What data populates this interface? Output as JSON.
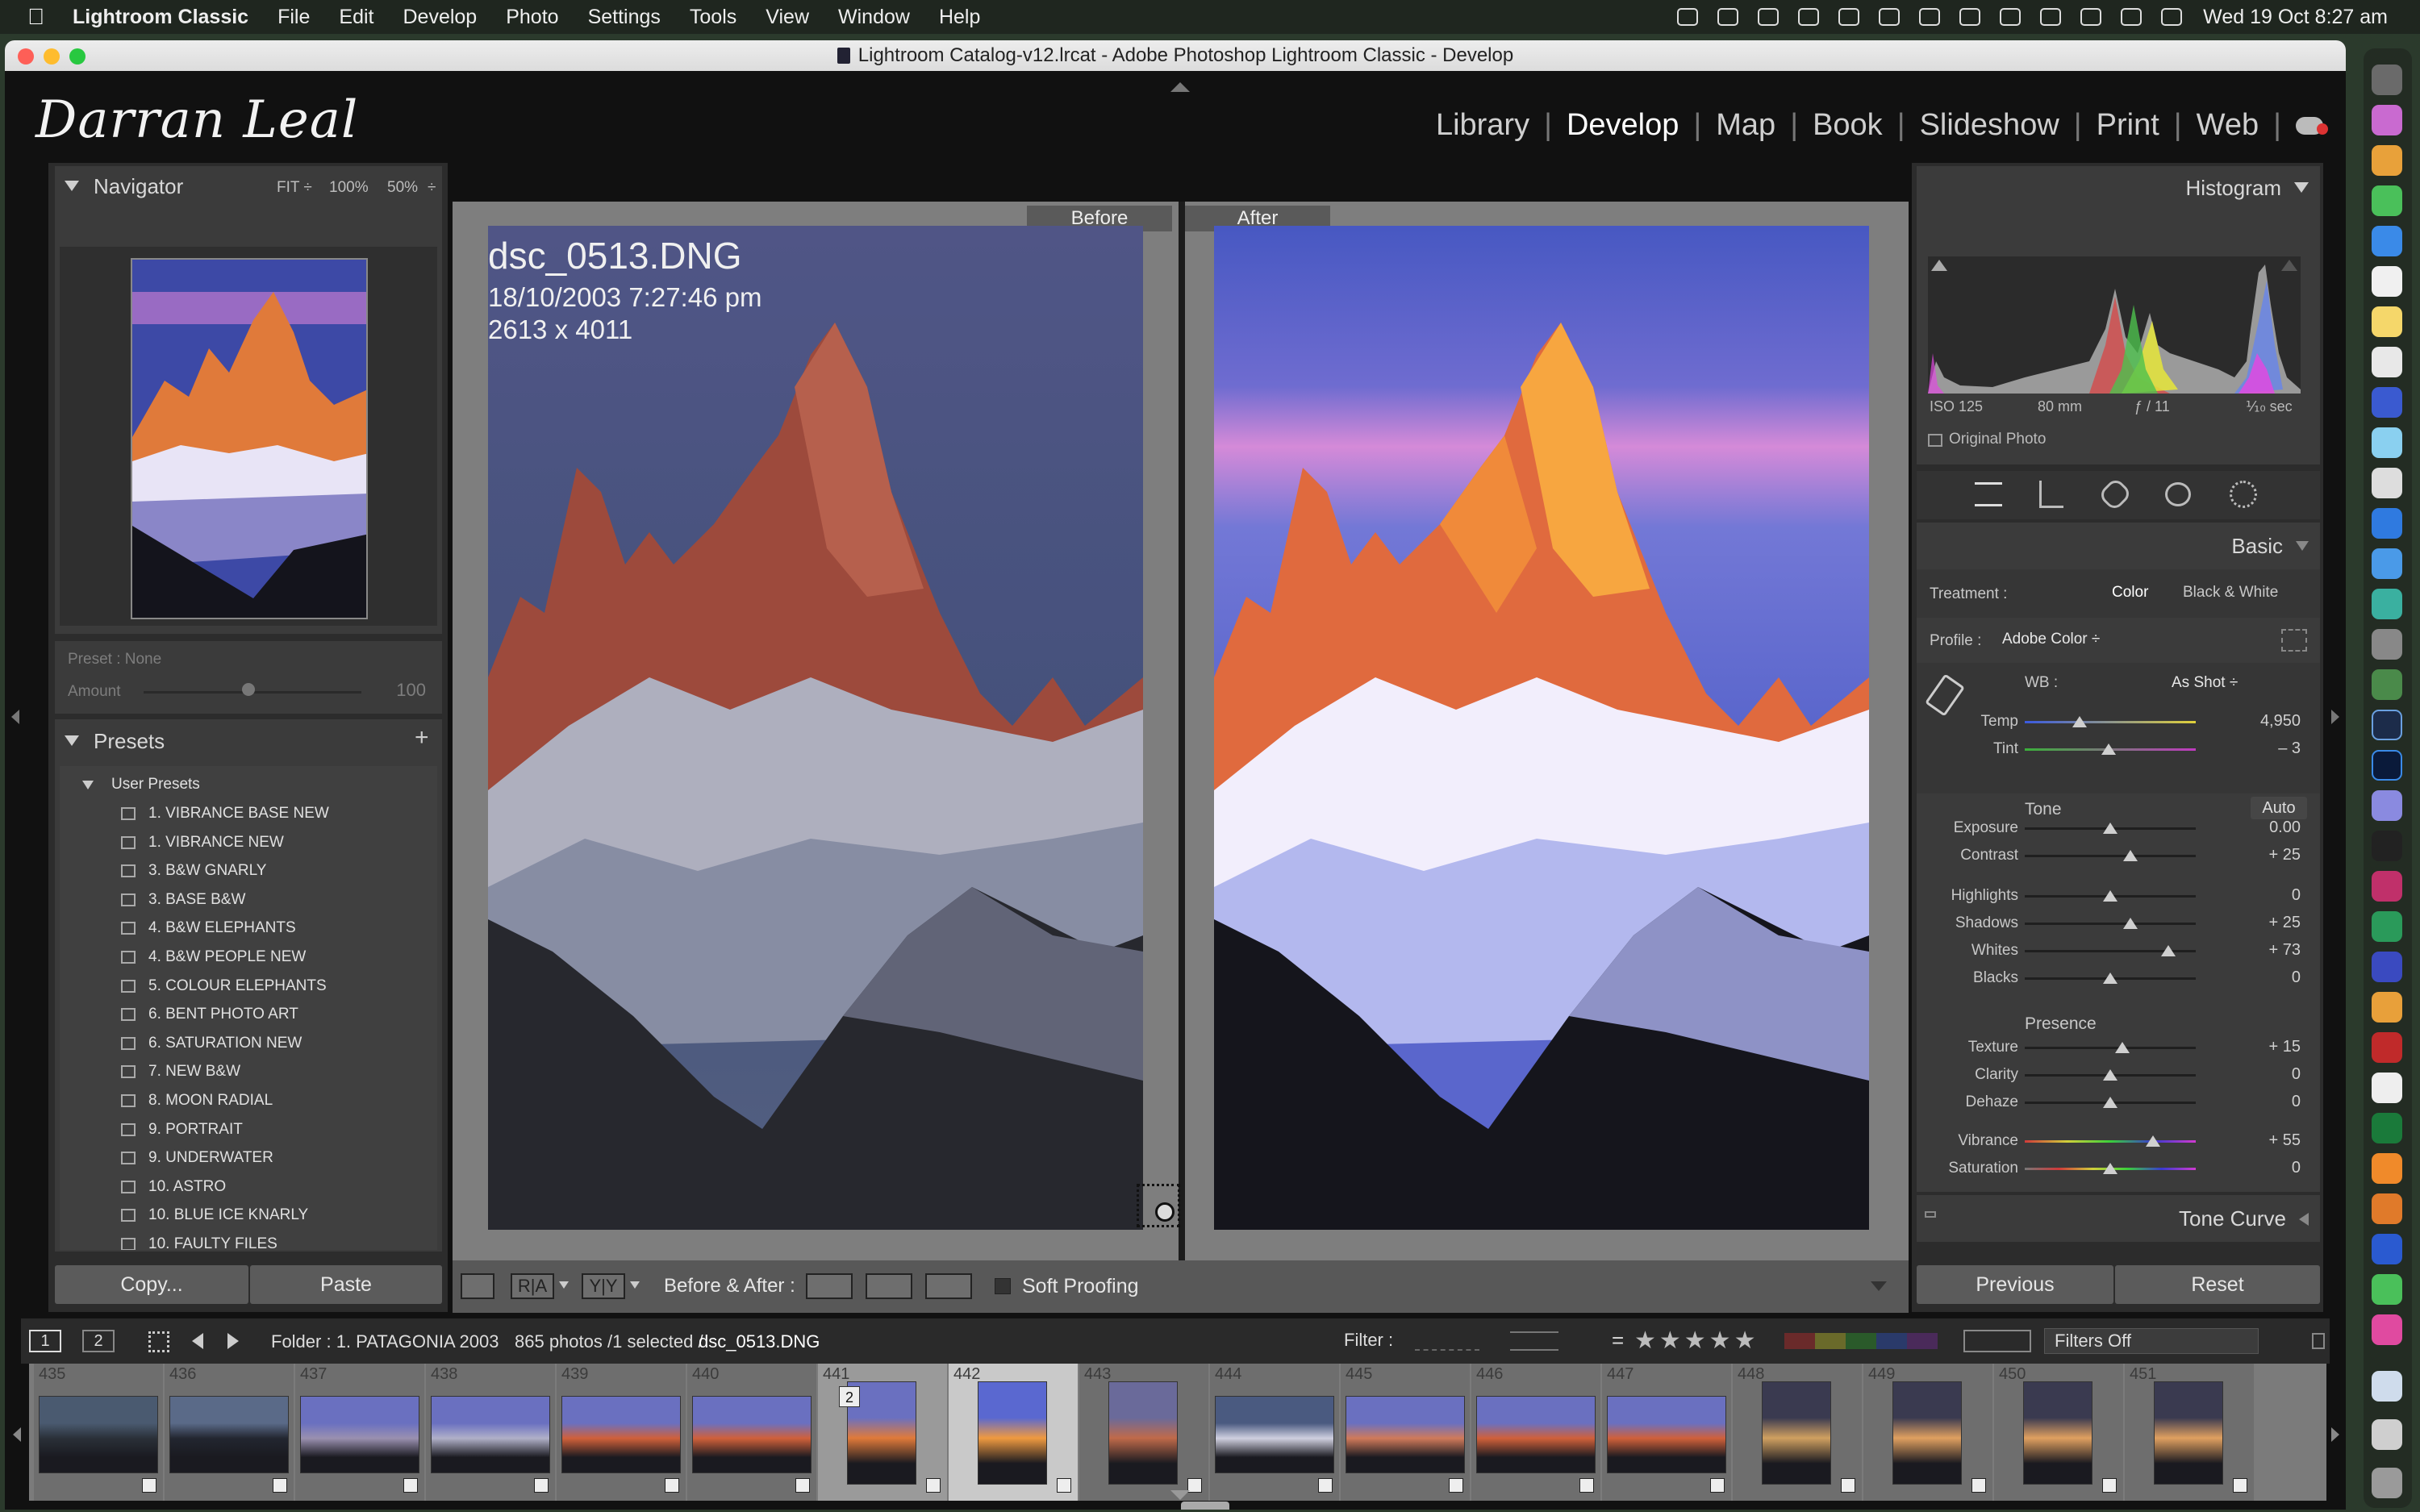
{
  "menubar": {
    "app_name": "Lightroom Classic",
    "items": [
      "File",
      "Edit",
      "Develop",
      "Photo",
      "Settings",
      "Tools",
      "View",
      "Window",
      "Help"
    ],
    "clock": "Wed 19 Oct  8:27 am"
  },
  "window": {
    "title": "Lightroom Catalog-v12.lrcat - Adobe Photoshop Lightroom Classic - Develop"
  },
  "identity_plate": "Darran Leal",
  "modules": [
    "Library",
    "Develop",
    "Map",
    "Book",
    "Slideshow",
    "Print",
    "Web"
  ],
  "active_module": "Develop",
  "navigator": {
    "title": "Navigator",
    "zoom_options": [
      "FIT ÷",
      "100%",
      "50%",
      "÷"
    ]
  },
  "preset_amount": {
    "preset_label": "Preset : None",
    "amount_label": "Amount",
    "amount_value": "100"
  },
  "presets": {
    "title": "Presets",
    "add_icon": "+",
    "group": "User Presets",
    "items": [
      "1. VIBRANCE BASE NEW",
      "1. VIBRANCE NEW",
      "3. B&W GNARLY",
      "3. BASE B&W",
      "4. B&W ELEPHANTS",
      "4. B&W PEOPLE NEW",
      "5. COLOUR ELEPHANTS",
      "6. BENT PHOTO ART",
      "6. SATURATION NEW",
      "7. NEW B&W",
      "8. MOON RADIAL",
      "9. PORTRAIT",
      "9. UNDERWATER",
      "10. ASTRO",
      "10. BLUE ICE KNARLY",
      "10. FAULTY FILES"
    ]
  },
  "left_buttons": {
    "copy": "Copy...",
    "paste": "Paste"
  },
  "photo_info": {
    "filename": "dsc_0513.DNG",
    "datetime": "18/10/2003 7:27:46 pm",
    "dimensions": "2613 x 4011"
  },
  "before_after": {
    "before": "Before",
    "after": "After"
  },
  "toolbar": {
    "before_after_label": "Before & After :",
    "soft_proofing": "Soft Proofing",
    "ra_label": "R|A",
    "yy_label": "Y|Y"
  },
  "histogram": {
    "title": "Histogram",
    "iso": "ISO 125",
    "focal": "80 mm",
    "aperture": "ƒ / 11",
    "shutter": "⅒ sec",
    "original_photo": "Original Photo"
  },
  "basic": {
    "title": "Basic",
    "treatment_label": "Treatment :",
    "treatment_color": "Color",
    "treatment_bw": "Black & White",
    "profile_label": "Profile :",
    "profile_value": "Adobe Color ÷",
    "wb_label": "WB :",
    "wb_value": "As Shot ÷",
    "tone_label": "Tone",
    "auto_label": "Auto",
    "presence_label": "Presence",
    "sliders": [
      {
        "label": "Temp",
        "value": "4,950",
        "pos": 0.32
      },
      {
        "label": "Tint",
        "value": "– 3",
        "pos": 0.49
      },
      {
        "label": "Exposure",
        "value": "0.00",
        "pos": 0.5
      },
      {
        "label": "Contrast",
        "value": "+ 25",
        "pos": 0.62
      },
      {
        "label": "Highlights",
        "value": "0",
        "pos": 0.5
      },
      {
        "label": "Shadows",
        "value": "+ 25",
        "pos": 0.62
      },
      {
        "label": "Whites",
        "value": "+ 73",
        "pos": 0.84
      },
      {
        "label": "Blacks",
        "value": "0",
        "pos": 0.5
      },
      {
        "label": "Texture",
        "value": "+ 15",
        "pos": 0.57
      },
      {
        "label": "Clarity",
        "value": "0",
        "pos": 0.5
      },
      {
        "label": "Dehaze",
        "value": "0",
        "pos": 0.5
      },
      {
        "label": "Vibrance",
        "value": "+ 55",
        "pos": 0.75
      },
      {
        "label": "Saturation",
        "value": "0",
        "pos": 0.5
      }
    ]
  },
  "tone_curve": {
    "title": "Tone Curve"
  },
  "right_buttons": {
    "previous": "Previous",
    "reset": "Reset"
  },
  "filmstrip_bar": {
    "page1": "1",
    "page2": "2",
    "folder": "Folder : 1. PATAGONIA 2003",
    "count": "865 photos /1 selected /",
    "current_file": "dsc_0513.DNG",
    "filter_label": "Filter :",
    "filter_op": "=",
    "filters_value": "Filters Off"
  },
  "filmstrip": {
    "numbers": [
      "435",
      "436",
      "437",
      "438",
      "439",
      "440",
      "441",
      "442",
      "443",
      "444",
      "445",
      "446",
      "447",
      "448",
      "449",
      "450",
      "451"
    ],
    "selected_index": 6,
    "active_index": 7,
    "stack_badge": "2"
  },
  "colors": {
    "panel_bg": "#3b3b3b",
    "center_bg": "#7e7e7e",
    "window_bg": "#111111",
    "accent_orange": "#e8822c"
  }
}
